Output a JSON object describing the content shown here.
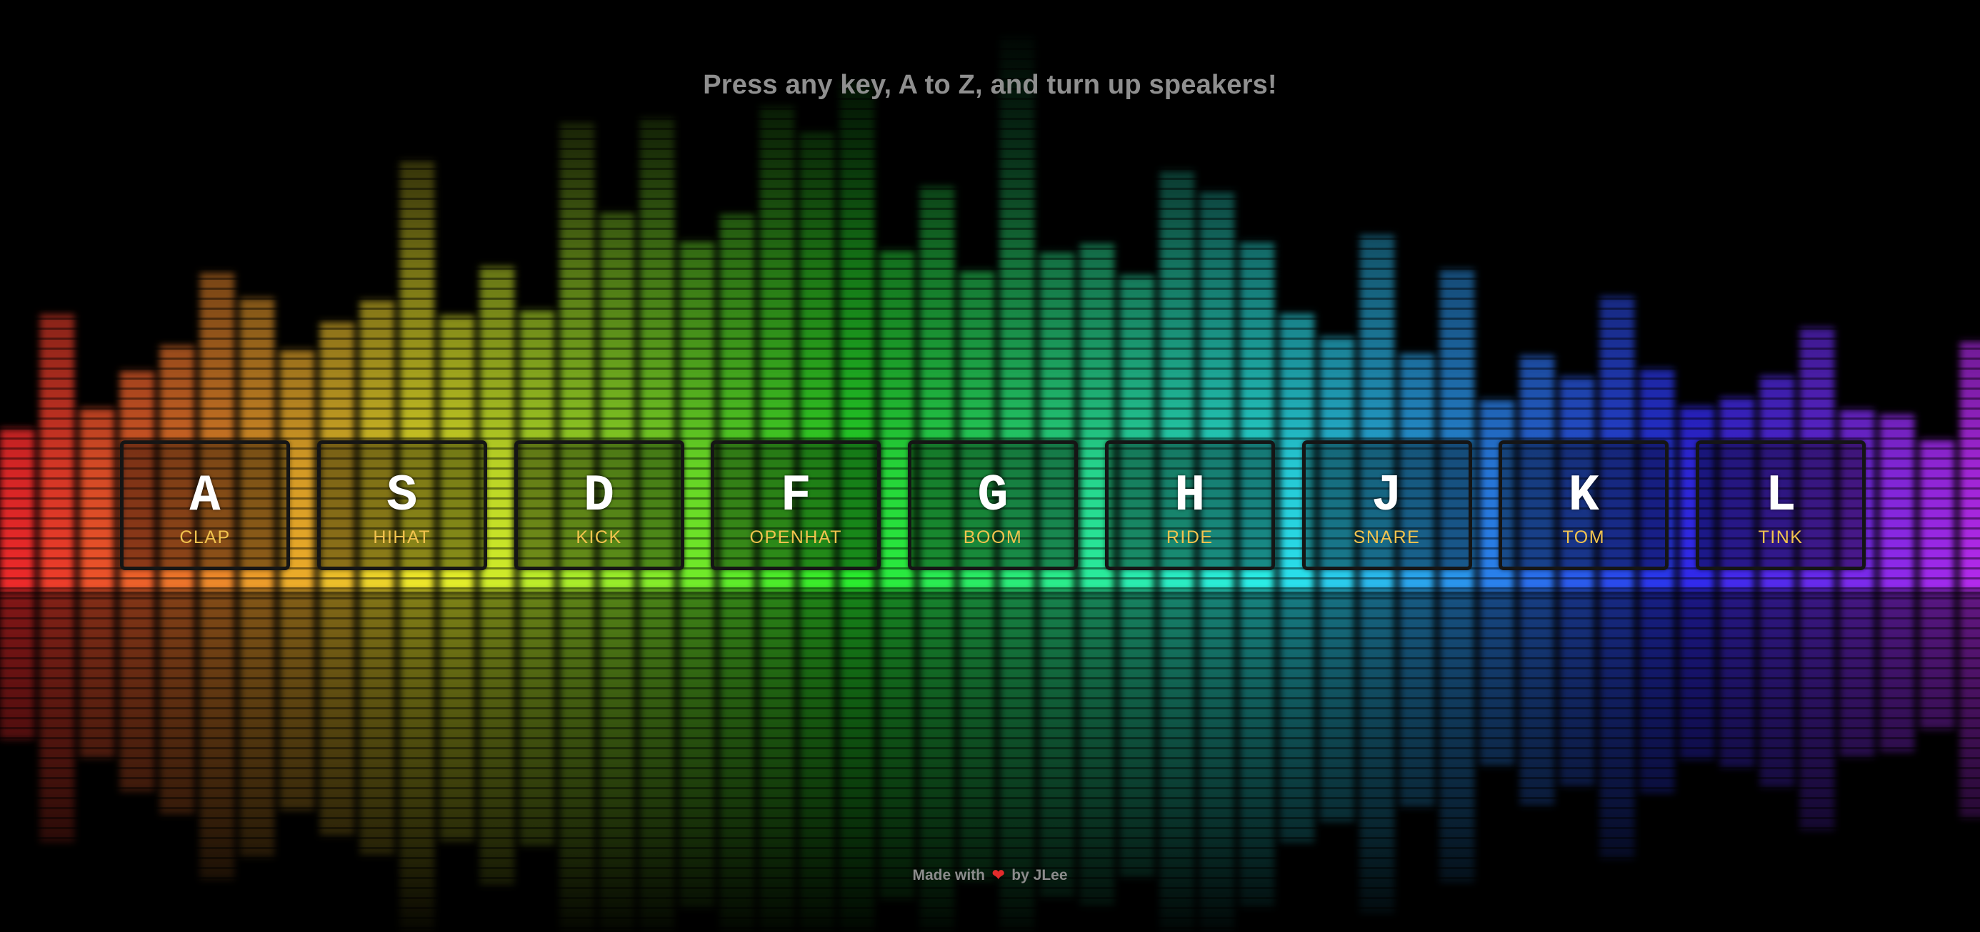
{
  "header": {
    "instruction": "Press any key, A to Z, and turn up speakers!"
  },
  "keys": [
    {
      "letter": "A",
      "sound": "CLAP"
    },
    {
      "letter": "S",
      "sound": "HIHAT"
    },
    {
      "letter": "D",
      "sound": "KICK"
    },
    {
      "letter": "F",
      "sound": "OPENHAT"
    },
    {
      "letter": "G",
      "sound": "BOOM"
    },
    {
      "letter": "H",
      "sound": "RIDE"
    },
    {
      "letter": "J",
      "sound": "SNARE"
    },
    {
      "letter": "K",
      "sound": "TOM"
    },
    {
      "letter": "L",
      "sound": "TINK"
    }
  ],
  "footer": {
    "made_with": "Made with",
    "heart_icon": "heart-icon",
    "heart_glyph": "❤",
    "by": "by JLee"
  },
  "colors": {
    "heading_text": "#8f8f8f",
    "key_letter": "#ffffff",
    "key_sound": "#f2c34e",
    "key_border": "#151515",
    "heart": "#e22b2b",
    "background": "#000000"
  }
}
